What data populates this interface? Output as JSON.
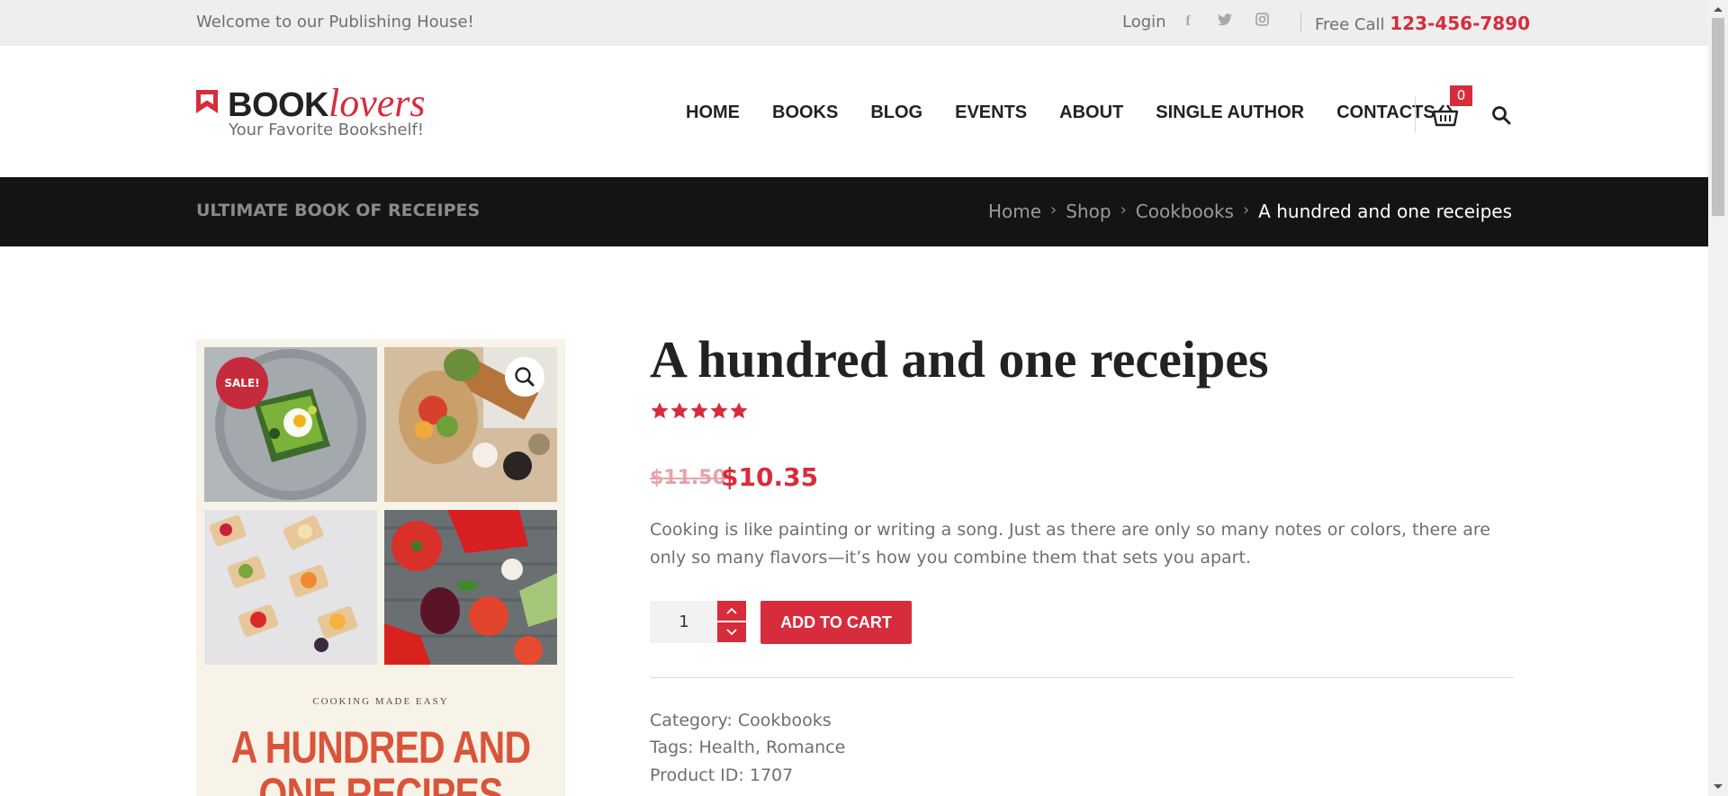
{
  "topbar": {
    "welcome": "Welcome to our Publishing House!",
    "login": "Login",
    "free_call_label": "Free Call",
    "phone": "123-456-7890",
    "social": [
      "facebook-icon",
      "twitter-icon",
      "instagram-icon"
    ]
  },
  "logo": {
    "book": "BOOK",
    "lovers": "lovers",
    "tagline": "Your Favorite Bookshelf!"
  },
  "nav": [
    "HOME",
    "BOOKS",
    "BLOG",
    "EVENTS",
    "ABOUT",
    "SINGLE AUTHOR",
    "CONTACTS"
  ],
  "cart": {
    "count": "0"
  },
  "band": {
    "title": "ULTIMATE BOOK OF RECEIPES",
    "breadcrumb": [
      "Home",
      "Shop",
      "Cookbooks",
      "A hundred and one receipes"
    ]
  },
  "product_image": {
    "sale_badge": "SALE!",
    "cover_subtitle": "COOKING MADE EASY",
    "cover_title_line1": "A HUNDRED AND",
    "cover_title_line2": "ONE RECIPES"
  },
  "product": {
    "title": "A hundred and one receipes",
    "rating": 5,
    "rating_max": 5,
    "old_price": "$11.50",
    "new_price": "$10.35",
    "description": "Cooking is like painting or writing a song. Just as there are only so many notes or colors, there are only so many flavors—it’s how you combine them that sets you apart.",
    "quantity": "1",
    "add_to_cart": "ADD TO CART",
    "category_label": "Category:",
    "category": "Cookbooks",
    "tags_label": "Tags:",
    "tags": "Health, Romance",
    "product_id_label": "Product ID:",
    "product_id": "1707"
  },
  "colors": {
    "accent": "#d72c3c",
    "band": "#141414",
    "topbar": "#eeeeee"
  }
}
